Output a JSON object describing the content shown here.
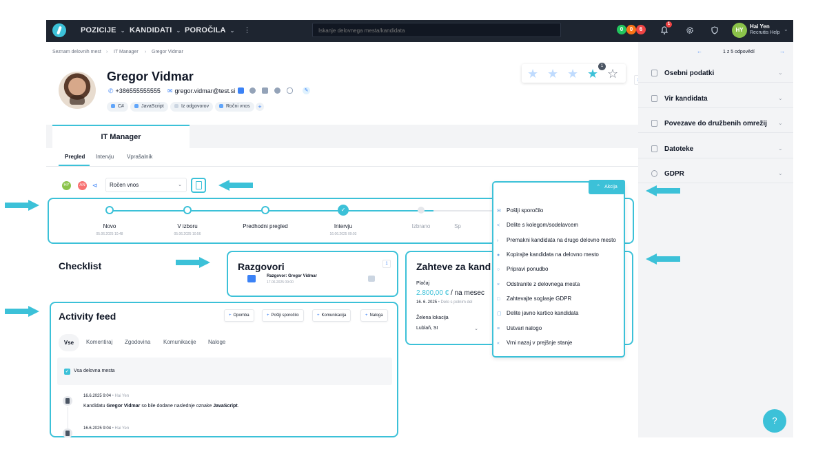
{
  "nav": {
    "items": [
      "POZICIJE",
      "KANDIDATI",
      "POROČILA"
    ],
    "search_placeholder": "Iskanje delovnega mesta/kandidata",
    "badges": [
      {
        "value": "0",
        "color": "#22c55e"
      },
      {
        "value": "0",
        "color": "#f97316"
      },
      {
        "value": "6",
        "color": "#ef4444"
      }
    ],
    "notification_count": "1",
    "user": {
      "initials": "HY",
      "name": "Hai Yen",
      "role": "Recruitis Help"
    }
  },
  "breadcrumb": [
    "Seznam delovnih mest",
    "IT Manager",
    "Gregor Vidmar"
  ],
  "candidate": {
    "name": "Gregor Vidmar",
    "phone": "+386555555555",
    "email": "gregor.vidmar@test.si",
    "tags": [
      "C#",
      "JavaScript",
      "Iz odgovorov",
      "Ročni vnos"
    ],
    "rating": 4,
    "rating_badge": "1"
  },
  "job_tab": "IT Manager",
  "subtabs": [
    "Pregled",
    "Intervju",
    "Vprašalnik"
  ],
  "toolbar": {
    "avatars": [
      "HY",
      "AN"
    ],
    "source_select": "Ročen vnos"
  },
  "pipeline": [
    {
      "label": "Novo",
      "date": "05.06.2025 10:48"
    },
    {
      "label": "V izboru",
      "date": "05.06.2025 10:56"
    },
    {
      "label": "Predhodni pregled",
      "date": ""
    },
    {
      "label": "Intervju",
      "date": "16.06.2025 09:03"
    },
    {
      "label": "Izbrano",
      "date": ""
    },
    {
      "label": "Sp",
      "date": ""
    }
  ],
  "checklist": {
    "title": "Checklist"
  },
  "razgovori": {
    "title": "Razgovori",
    "item_title": "Razgovor: Gregor Vidmar",
    "item_date": "17.06.2025 09:00",
    "badge": "1"
  },
  "zahteve": {
    "title": "Zahteve za kand",
    "salary_label": "Plačaj",
    "salary_value": "2.800,00 €",
    "salary_unit": "/ na mesec",
    "salary_date": "16. 6. 2025",
    "salary_note": "Delo s polnim del",
    "location_label": "Želena lokacija",
    "location_value": "Lublaň, SI"
  },
  "activity": {
    "title": "Activity feed",
    "buttons": [
      "Opomba",
      "Pošlji sporočilo",
      "Komunikacija",
      "Naloga"
    ],
    "tabs": [
      "Vse",
      "Komentiraj",
      "Zgodovina",
      "Komunikacije",
      "Naloge"
    ],
    "filter_label": "Vsa delovna mesta",
    "entries": [
      {
        "time": "16.6.2025 9:04",
        "author": "Hai Yen",
        "text_a": "Kandidatu ",
        "bold_a": "Gregor Vidmar",
        "text_b": " so bile dodane naslednje oznake ",
        "bold_b": "JavaScript",
        "text_c": "."
      },
      {
        "time": "16.6.2025 9:04",
        "author": "Hai Yen"
      }
    ]
  },
  "actions": {
    "button": "Akcija",
    "items": [
      "Pošlji sporočilo",
      "Delite s kolegom/sodelavcem",
      "Premakni kandidata na drugo delovno mesto",
      "Kopirajte kandidata na delovno mesto",
      "Pripravi ponudbo",
      "Odstranite z delovnega mesta",
      "Zahtevajte soglasje GDPR",
      "Delite javno kartico kandidata",
      "Ustvari nalogo",
      "Vrni nazaj v prejšnje stanje"
    ]
  },
  "right": {
    "pager": "1 z 5 odpovědí",
    "sections": [
      "Osebni podatki",
      "Vir kandidata",
      "Povezave do družbenih omrežij",
      "Datoteke",
      "GDPR"
    ]
  },
  "help": "?",
  "colors": {
    "accent": "#3cc1d8",
    "nav_bg": "#1e2530",
    "link": "#3b82f6"
  }
}
